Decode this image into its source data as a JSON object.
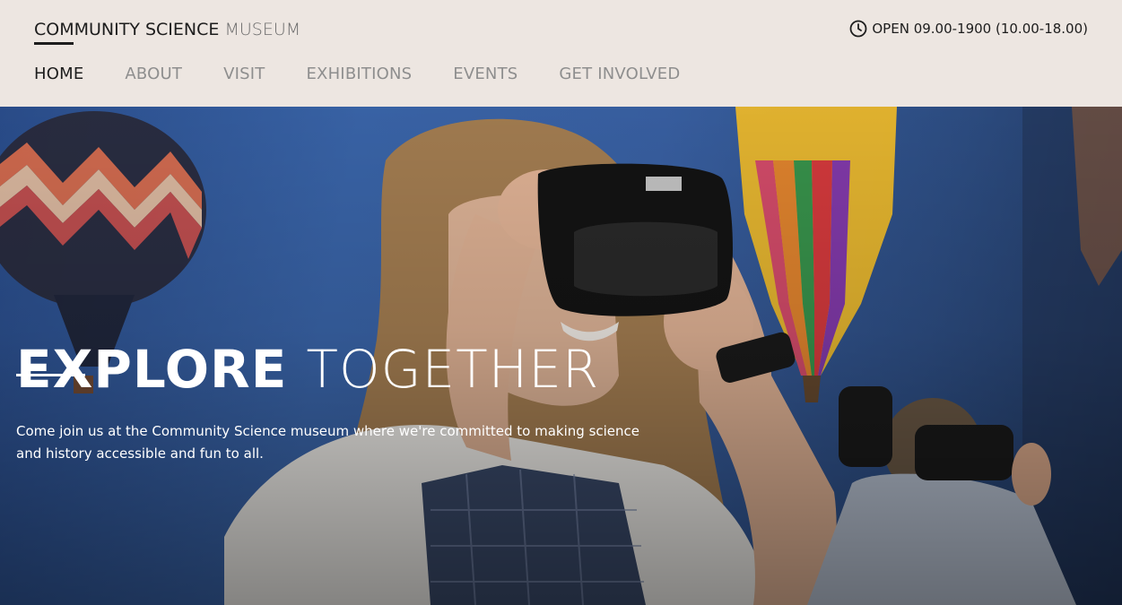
{
  "header": {
    "logo_main": "COMMUNITY SCIENCE",
    "logo_sub": "MUSEUM",
    "hours_text": "OPEN 09.00-1900 (10.00-18.00)",
    "clock_icon": "clock-icon"
  },
  "nav": {
    "items": [
      {
        "label": "HOME"
      },
      {
        "label": "ABOUT"
      },
      {
        "label": "VISIT"
      },
      {
        "label": "EXHIBITIONS"
      },
      {
        "label": "EVENTS"
      },
      {
        "label": "GET INVOLVED"
      }
    ],
    "active": "HOME"
  },
  "hero": {
    "title_bold": "EXPLORE",
    "title_light": "TOGETHER",
    "body": "Come join us at the Community Science museum where we're committed to making science and history accessible and fun to all."
  },
  "colors": {
    "header_bg": "#ede6e1",
    "text_dark": "#1d1d1d",
    "nav_inactive": "#8e8e8e",
    "hero_text": "#ffffff"
  }
}
